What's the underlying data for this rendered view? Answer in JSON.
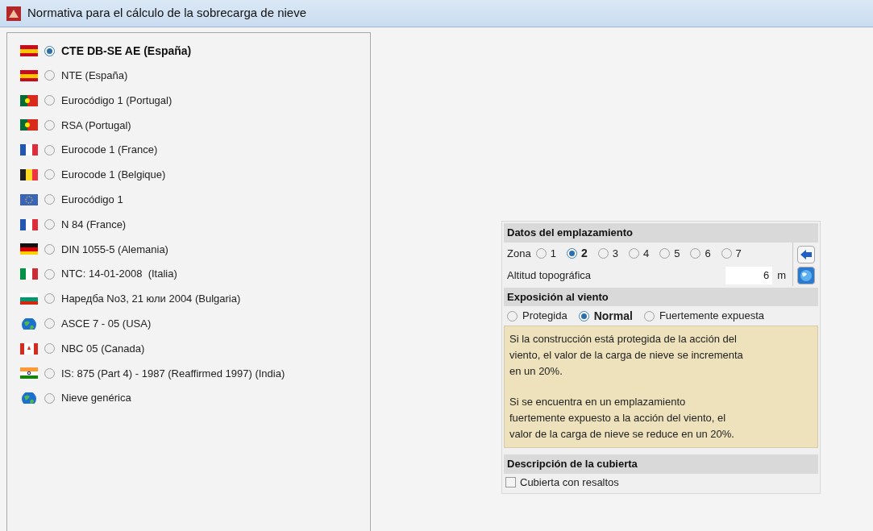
{
  "window": {
    "title": "Normativa para el cálculo de la sobrecarga de nieve"
  },
  "standards": [
    {
      "label": "CTE DB-SE AE (España)",
      "selected": true
    },
    {
      "label": "NTE (España)",
      "selected": false
    },
    {
      "label": "Eurocódigo 1 (Portugal)",
      "selected": false
    },
    {
      "label": "RSA (Portugal)",
      "selected": false
    },
    {
      "label": "Eurocode 1 (France)",
      "selected": false
    },
    {
      "label": "Eurocode 1 (Belgique)",
      "selected": false
    },
    {
      "label": "Eurocódigo 1",
      "selected": false
    },
    {
      "label": "N 84 (France)",
      "selected": false
    },
    {
      "label": "DIN 1055-5 (Alemania)",
      "selected": false
    },
    {
      "label": "NTC: 14-01-2008  (Italia)",
      "selected": false
    },
    {
      "label": "Наредба No3, 21 юли 2004 (Bulgaria)",
      "selected": false
    },
    {
      "label": "ASCE 7 - 05 (USA)",
      "selected": false
    },
    {
      "label": "NBC 05 (Canada)",
      "selected": false
    },
    {
      "label": "IS: 875 (Part 4) - 1987 (Reaffirmed 1997) (India)",
      "selected": false
    },
    {
      "label": "Nieve genérica",
      "selected": false
    }
  ],
  "site": {
    "title": "Datos del emplazamiento",
    "zone_label": "Zona",
    "zones": [
      {
        "label": "1",
        "selected": false
      },
      {
        "label": "2",
        "selected": true
      },
      {
        "label": "3",
        "selected": false
      },
      {
        "label": "4",
        "selected": false
      },
      {
        "label": "5",
        "selected": false
      },
      {
        "label": "6",
        "selected": false
      },
      {
        "label": "7",
        "selected": false
      }
    ],
    "altitude_label": "Altitud topográfica",
    "altitude_value": "6",
    "altitude_unit": "m"
  },
  "wind": {
    "title": "Exposición al viento",
    "options": [
      {
        "label": "Protegida",
        "selected": false
      },
      {
        "label": "Normal",
        "selected": true
      },
      {
        "label": "Fuertemente expuesta",
        "selected": false
      }
    ],
    "notes": [
      "Si la construcción está protegida de la acción del viento, el valor de la carga de nieve se incrementa en un 20%.",
      "Si se encuentra en un emplazamiento fuertemente expuesto a la acción del viento, el valor de la carga de nieve se reduce en un 20%."
    ]
  },
  "roof": {
    "title": "Descripción de la cubierta",
    "checkbox": {
      "label": "Cubierta con resaltos",
      "checked": false
    }
  }
}
